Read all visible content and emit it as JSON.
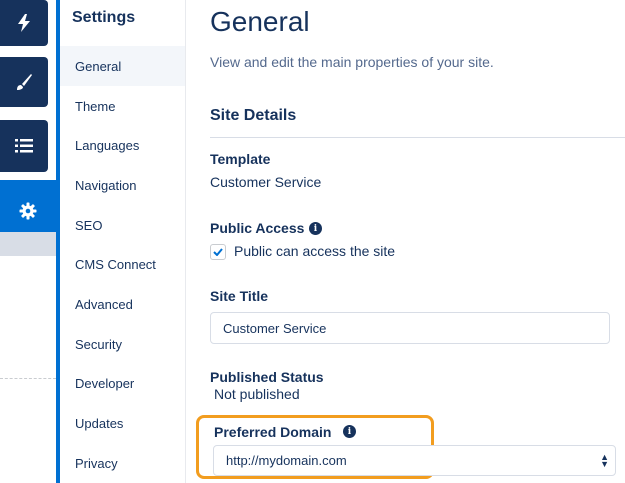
{
  "rail": {
    "items": [
      {
        "icon": "lightning-icon"
      },
      {
        "icon": "brush-icon"
      },
      {
        "icon": "list-icon"
      },
      {
        "icon": "gear-icon"
      }
    ]
  },
  "nav": {
    "title": "Settings",
    "items": [
      {
        "label": "General",
        "active": true
      },
      {
        "label": "Theme"
      },
      {
        "label": "Languages"
      },
      {
        "label": "Navigation"
      },
      {
        "label": "SEO"
      },
      {
        "label": "CMS Connect"
      },
      {
        "label": "Advanced"
      },
      {
        "label": "Security"
      },
      {
        "label": "Developer"
      },
      {
        "label": "Updates"
      },
      {
        "label": "Privacy"
      }
    ]
  },
  "main": {
    "title": "General",
    "description": "View and edit the main properties of your site.",
    "section_title": "Site Details",
    "template": {
      "label": "Template",
      "value": "Customer Service"
    },
    "public_access": {
      "label": "Public Access",
      "checkbox_label": "Public can access the site",
      "checked": true
    },
    "site_title": {
      "label": "Site Title",
      "value": "Customer Service"
    },
    "published_status": {
      "label": "Published Status",
      "value": "Not published"
    },
    "preferred_domain": {
      "label": "Preferred Domain",
      "selected": "http://mydomain.com"
    }
  },
  "colors": {
    "navy": "#16325c",
    "accent": "#0070d2",
    "highlight": "#f29d1f"
  }
}
